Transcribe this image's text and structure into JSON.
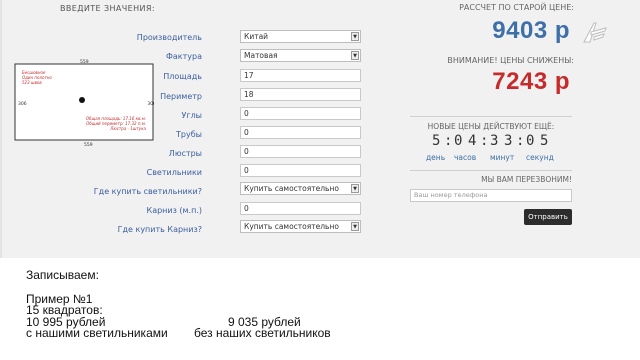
{
  "form": {
    "title": "ВВЕДИТЕ ЗНАЧЕНИЯ:",
    "rows": [
      {
        "label": "Производитель",
        "value": "Китай",
        "type": "select"
      },
      {
        "label": "Фактура",
        "value": "Матовая",
        "type": "select"
      },
      {
        "label": "Площадь",
        "value": "17",
        "type": "input"
      },
      {
        "label": "Периметр",
        "value": "18",
        "type": "input"
      },
      {
        "label": "Углы",
        "value": "0",
        "type": "input"
      },
      {
        "label": "Трубы",
        "value": "0",
        "type": "input"
      },
      {
        "label": "Люстры",
        "value": "0",
        "type": "input"
      },
      {
        "label": "Светильники",
        "value": "0",
        "type": "input"
      },
      {
        "label": "Где купить светильники?",
        "value": "Купить самостоятельно",
        "type": "select"
      },
      {
        "label": "Карниз (м.п.)",
        "value": "0",
        "type": "input"
      },
      {
        "label": "Где купить Карниз?",
        "value": "Купить самостоятельно",
        "type": "select"
      }
    ]
  },
  "diagram": {
    "top": "559",
    "bottom": "559",
    "left": "306",
    "right": "306",
    "legend_top": [
      "Бесшовное",
      "Один полотно",
      "523 швов"
    ],
    "legend_bottom": [
      "Общая площадь: 17.16 кв.м.",
      "Общий периметр: 17.32 п.м.",
      "Люстра - 1штука"
    ]
  },
  "prices": {
    "old_label": "РАССЧЕТ ПО СТАРОЙ ЦЕНЕ:",
    "old_value": "9403 р",
    "warn_label": "ВНИМАНИЕ! ЦЕНЫ СНИЖЕНЫ:",
    "new_value": "7243 р"
  },
  "timer": {
    "label": "НОВЫЕ ЦЕНЫ ДЕЙСТВУЮТ ЕЩЁ:",
    "digits": [
      "5",
      "0",
      "4",
      "3",
      "3",
      "0",
      "5"
    ],
    "units": [
      "день",
      "часов",
      "минут",
      "секунд"
    ]
  },
  "callback": {
    "label": "МЫ ВАМ ПЕРЕЗВОНИМ!",
    "placeholder": "Ваш номер телефона",
    "button": "Отправить"
  },
  "caption": {
    "line1": "Записываем:",
    "line2": "Пример №1",
    "line3": "15 квадратов:",
    "line4a": "10 995 рублей",
    "line4b": "9 035 рублей",
    "line5a": "с нашими светильниками",
    "line5b": "без наших светильников"
  },
  "colors": {
    "accent_blue": "#3d6fa8",
    "accent_red": "#c62a2a",
    "button_dark": "#2c2c2c"
  }
}
